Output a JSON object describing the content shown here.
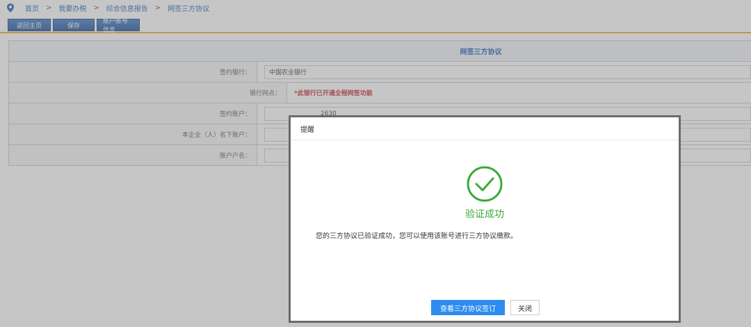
{
  "breadcrumb": {
    "items": [
      "首页",
      "我要办税",
      "综合信息报告",
      "网签三方协议"
    ],
    "separator": ">"
  },
  "toolbar": {
    "buttons": [
      "返回主页",
      "保存",
      "账户账号信息"
    ]
  },
  "form": {
    "title": "网签三方协议",
    "rows": [
      {
        "label": "签约银行：",
        "value": "中国农业银行"
      },
      {
        "label": "银行网点：",
        "value": "*此银行已开通全程网签功能"
      },
      {
        "label": "签约账户：",
        "value": "2630"
      },
      {
        "label": "本企业（人）名下账户：",
        "value": ""
      },
      {
        "label": "账户户名：",
        "value": ""
      }
    ]
  },
  "modal": {
    "title": "提醒",
    "status_text": "验证成功",
    "message": "您的三方协议已验证成功，您可以使用该账号进行三方协议缴款。",
    "primary_button": "查看三方协议签订",
    "close_button": "关闭"
  },
  "colors": {
    "brand_blue": "#1a5fb4",
    "success_green": "#3aaa35",
    "primary_button": "#2d8cf0",
    "accent_orange": "#e8a53a",
    "warning_red": "#c0282d"
  },
  "icons": [
    "location-pin-icon",
    "check-circle-icon"
  ]
}
